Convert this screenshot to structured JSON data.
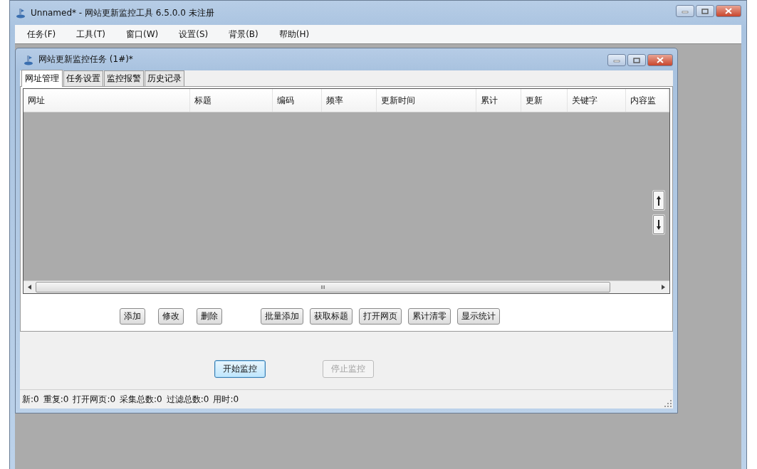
{
  "window": {
    "title": "Unnamed* - 网站更新监控工具 6.5.0.0  未注册"
  },
  "menu": [
    "任务(F)",
    "工具(T)",
    "窗口(W)",
    "设置(S)",
    "背景(B)",
    "帮助(H)"
  ],
  "child_window": {
    "title": "网站更新监控任务  (1#)*",
    "tabs": [
      {
        "label": "网址管理",
        "selected": true
      },
      {
        "label": "任务设置",
        "selected": false
      },
      {
        "label": "监控报警",
        "selected": false
      },
      {
        "label": "历史记录",
        "selected": false
      }
    ],
    "table": {
      "columns": [
        "网址",
        "标题",
        "编码",
        "频率",
        "更新时间",
        "累计",
        "更新",
        "关键字",
        "内容监"
      ]
    },
    "action_groups": [
      [
        "添加",
        "修改",
        "删除"
      ],
      [
        "批量添加",
        "获取标题",
        "打开网页",
        "累计清零",
        "显示统计"
      ]
    ],
    "controls": [
      {
        "label": "开始监控",
        "disabled": false
      },
      {
        "label": "停止监控",
        "disabled": true
      }
    ],
    "status_bar": [
      "新:0",
      "重复:0",
      "打开网页:0",
      "采集总数:0",
      "过滤总数:0",
      "用时:0"
    ]
  }
}
